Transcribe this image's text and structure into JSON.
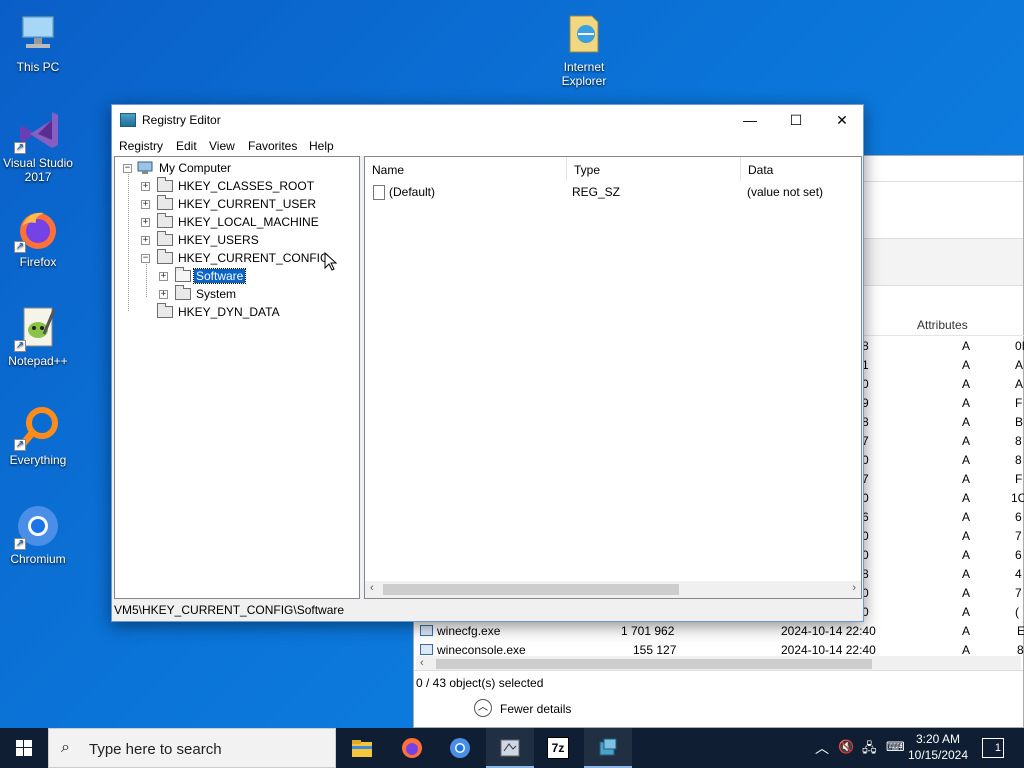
{
  "desktop": {
    "icons": [
      {
        "label": "This PC",
        "icon": "this-pc-icon"
      },
      {
        "label": "Visual Studio 2017",
        "icon": "visual-studio-icon"
      },
      {
        "label": "Firefox",
        "icon": "firefox-icon"
      },
      {
        "label": "Notepad++",
        "icon": "notepadpp-icon"
      },
      {
        "label": "Everything",
        "icon": "everything-icon"
      },
      {
        "label": "Chromium",
        "icon": "chromium-icon"
      },
      {
        "label": "Internet Explorer",
        "icon": "internet-explorer-icon"
      }
    ]
  },
  "explorer": {
    "column_attributes": "Attributes",
    "files": [
      {
        "name": "winecfg.exe",
        "size": "1 701 962",
        "date": "2024-10-14 22:40",
        "attr": "A"
      },
      {
        "name": "wineconsole.exe",
        "size": "155 127",
        "date": "2024-10-14 22:40",
        "attr": "A"
      }
    ],
    "partial_rows": [
      {
        "c1": "8",
        "a": "A",
        "c2": "0I"
      },
      {
        "c1": "1",
        "a": "A",
        "c2": "A"
      },
      {
        "c1": "0",
        "a": "A",
        "c2": "A"
      },
      {
        "c1": "9",
        "a": "A",
        "c2": "F"
      },
      {
        "c1": "8",
        "a": "A",
        "c2": "B"
      },
      {
        "c1": "7",
        "a": "A",
        "c2": "8"
      },
      {
        "c1": "0",
        "a": "A",
        "c2": "8"
      },
      {
        "c1": "7",
        "a": "A",
        "c2": "F"
      },
      {
        "c1": "0",
        "a": "A",
        "c2": "1C"
      },
      {
        "c1": "6",
        "a": "A",
        "c2": "6"
      },
      {
        "c1": "0",
        "a": "A",
        "c2": "7"
      },
      {
        "c1": "0",
        "a": "A",
        "c2": "6"
      },
      {
        "c1": "8",
        "a": "A",
        "c2": "4"
      },
      {
        "c1": "0",
        "a": "A",
        "c2": "7"
      },
      {
        "c1": "0",
        "a": "A",
        "c2": "("
      }
    ],
    "last_cols": [
      "E",
      "8"
    ],
    "status": "0 / 43 object(s) selected",
    "fewer_details": "Fewer details"
  },
  "regedit": {
    "title": "Registry Editor",
    "menu": [
      "Registry",
      "Edit",
      "View",
      "Favorites",
      "Help"
    ],
    "tree": {
      "root": "My Computer",
      "hives": [
        "HKEY_CLASSES_ROOT",
        "HKEY_CURRENT_USER",
        "HKEY_LOCAL_MACHINE",
        "HKEY_USERS",
        "HKEY_CURRENT_CONFIG"
      ],
      "children": [
        "Software",
        "System"
      ],
      "last": "HKEY_DYN_DATA"
    },
    "columns": {
      "name": "Name",
      "type": "Type",
      "data": "Data"
    },
    "values": [
      {
        "name": "(Default)",
        "type": "REG_SZ",
        "data": "(value not set)"
      }
    ],
    "status_path": "VM5\\HKEY_CURRENT_CONFIG\\Software"
  },
  "taskbar": {
    "search_placeholder": "Type here to search",
    "apps": [
      "file-explorer-icon",
      "firefox-icon",
      "chromium-icon",
      "wine-app-icon",
      "7zip-icon",
      "regedit-icon"
    ],
    "sevenzip_label": "7z",
    "clock_time": "3:20 AM",
    "clock_date": "10/15/2024",
    "notification_count": "1"
  }
}
